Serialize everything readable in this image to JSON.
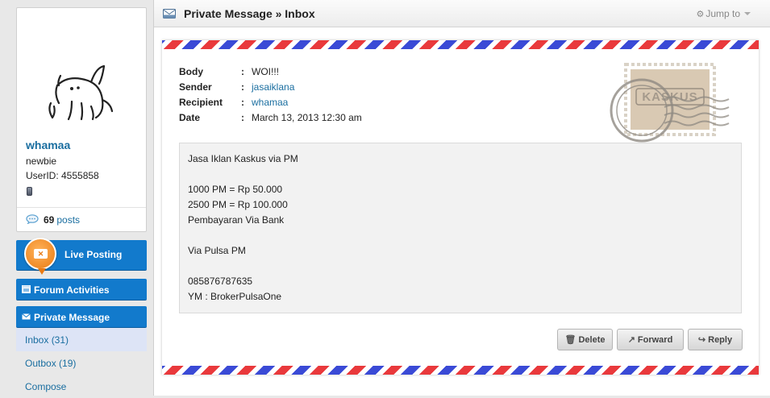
{
  "sidebar": {
    "username": "whamaa",
    "rank": "newbie",
    "userid": "UserID: 4555858",
    "posts_count": "69",
    "posts_label": "posts",
    "live_posting_label": "Live Posting",
    "forum_activities_label": "Forum Activities",
    "private_message_label": "Private Message",
    "pm_links": [
      {
        "label": "Inbox (31)",
        "active": true
      },
      {
        "label": "Outbox (19)",
        "active": false
      },
      {
        "label": "Compose",
        "active": false
      }
    ]
  },
  "header": {
    "title": "Private Message » Inbox",
    "jump_to": "Jump to"
  },
  "message": {
    "fields": [
      {
        "label": "Body",
        "value": "WOI!!!",
        "link": false
      },
      {
        "label": "Sender",
        "value": "jasaiklana",
        "link": true
      },
      {
        "label": "Recipient",
        "value": "whamaa",
        "link": true
      },
      {
        "label": "Date",
        "value": "March 13, 2013 12:30 am",
        "link": false
      }
    ],
    "stamp_text": "KASKUS",
    "body_lines": [
      "Jasa Iklan Kaskus via PM",
      "",
      "1000 PM = Rp 50.000",
      "2500 PM = Rp 100.000",
      "Pembayaran Via Bank",
      "",
      "Via Pulsa PM",
      "",
      "085876787635",
      "YM : BrokerPulsaOne"
    ]
  },
  "actions": {
    "delete_label": "Delete",
    "forward_label": "Forward",
    "reply_label": "Reply"
  },
  "colors": {
    "accent_blue": "#127acc",
    "link_blue": "#1a6ea0",
    "stripe_red": "#e9393c",
    "stripe_blue": "#3a4ad6"
  }
}
